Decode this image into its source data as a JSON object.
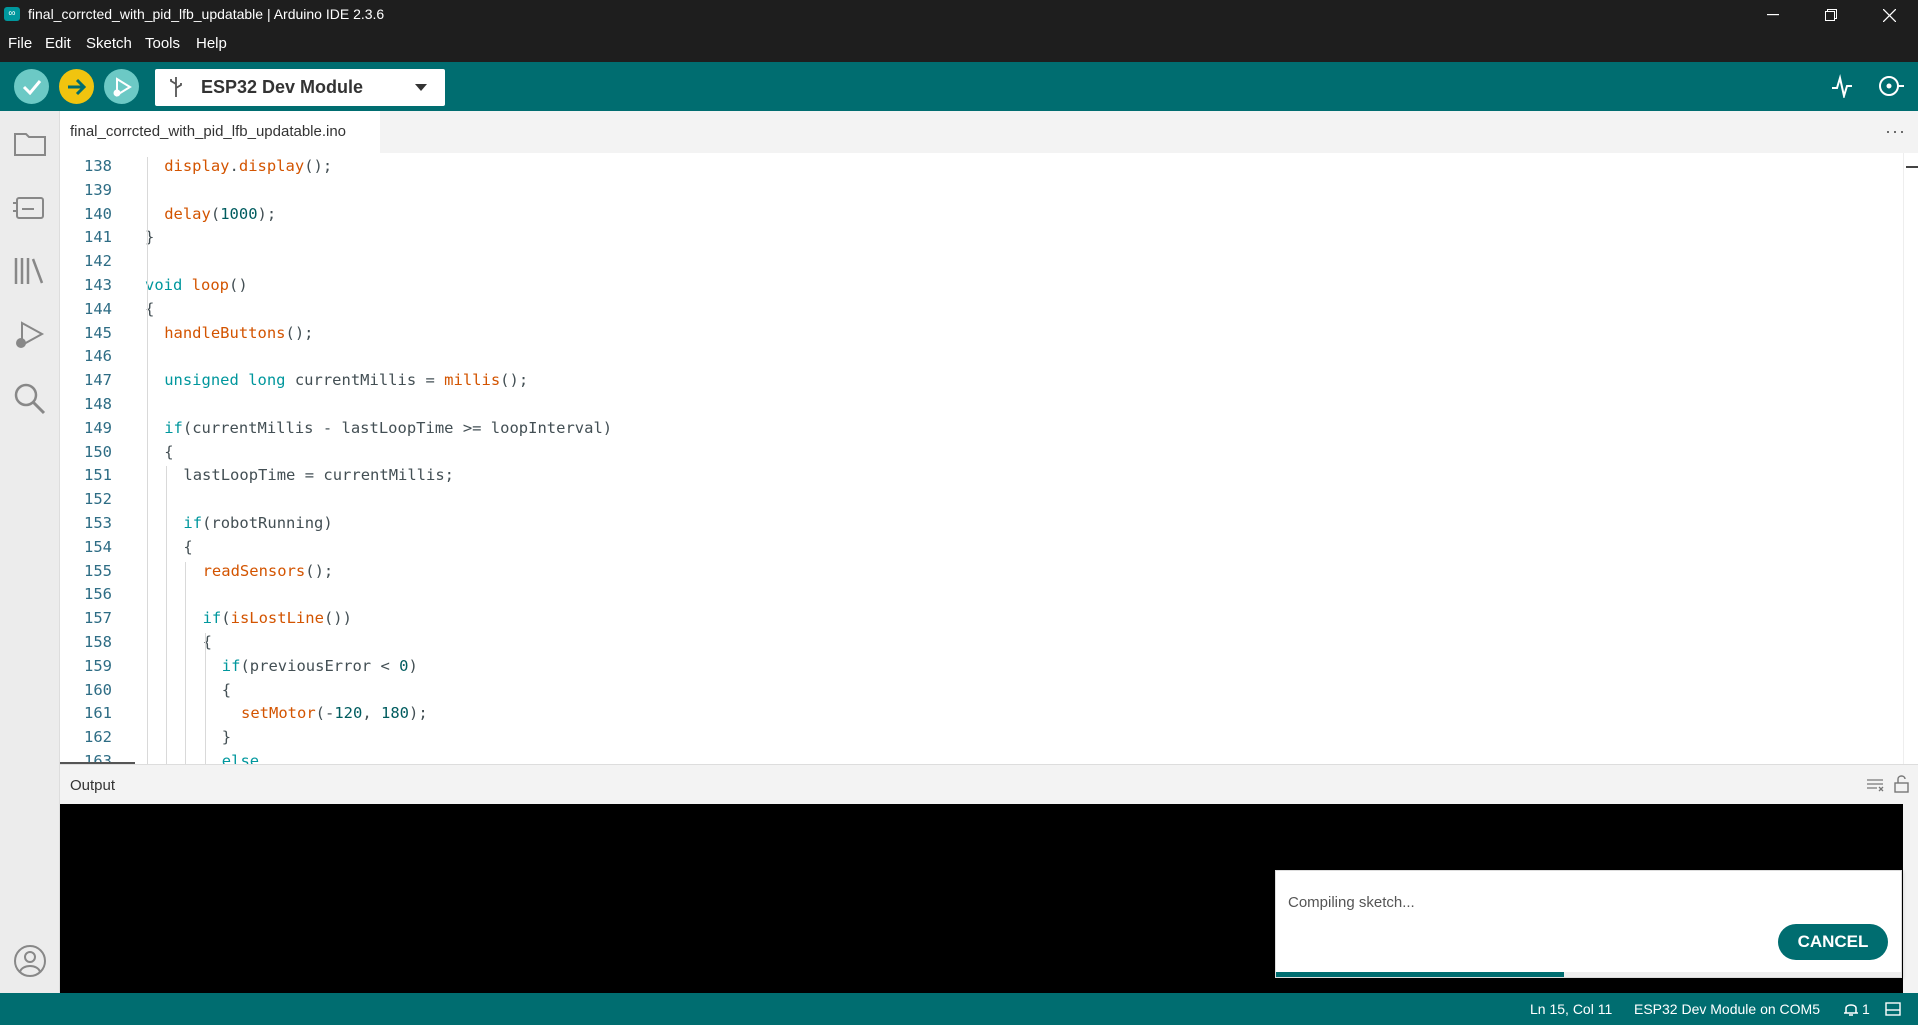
{
  "window": {
    "title": "final_corrcted_with_pid_lfb_updatable | Arduino IDE 2.3.6",
    "logo_symbol": "∞"
  },
  "menu": [
    "File",
    "Edit",
    "Sketch",
    "Tools",
    "Help"
  ],
  "toolbar": {
    "board": "ESP32 Dev Module",
    "colors": {
      "verify": "#6cc9c5",
      "upload": "#f1c40f",
      "bar": "#006d70"
    },
    "icons": [
      "checkmark-icon",
      "arrow-right-icon",
      "debug-icon",
      "serial-plotter-icon",
      "serial-monitor-icon"
    ]
  },
  "sidebar": {
    "icons": [
      "folder-icon",
      "board-manager-icon",
      "library-icon",
      "debug-icon",
      "search-icon",
      "account-icon"
    ]
  },
  "editor": {
    "tab_label": "final_corrcted_with_pid_lfb_updatable.ino",
    "more_label": "···",
    "lines": [
      {
        "n": "138",
        "indent": 1,
        "tokens": [
          [
            "fn",
            "display"
          ],
          [
            "",
            "."
          ],
          [
            "fn",
            "display"
          ],
          [
            "",
            "();"
          ]
        ]
      },
      {
        "n": "139",
        "indent": 0,
        "tokens": []
      },
      {
        "n": "140",
        "indent": 1,
        "tokens": [
          [
            "fn",
            "delay"
          ],
          [
            "",
            "("
          ],
          [
            "num",
            "1000"
          ],
          [
            "",
            ");"
          ]
        ]
      },
      {
        "n": "141",
        "indent": 0,
        "tokens": [
          [
            "",
            "}"
          ]
        ]
      },
      {
        "n": "142",
        "indent": 0,
        "tokens": []
      },
      {
        "n": "143",
        "indent": 0,
        "tokens": [
          [
            "kw",
            "void"
          ],
          [
            "",
            " "
          ],
          [
            "fn",
            "loop"
          ],
          [
            "",
            "()"
          ]
        ]
      },
      {
        "n": "144",
        "indent": 0,
        "tokens": [
          [
            "",
            "{"
          ]
        ]
      },
      {
        "n": "145",
        "indent": 1,
        "tokens": [
          [
            "fn",
            "handleButtons"
          ],
          [
            "",
            "();"
          ]
        ]
      },
      {
        "n": "146",
        "indent": 0,
        "tokens": []
      },
      {
        "n": "147",
        "indent": 1,
        "tokens": [
          [
            "kw",
            "unsigned"
          ],
          [
            "",
            " "
          ],
          [
            "kw",
            "long"
          ],
          [
            "",
            " currentMillis = "
          ],
          [
            "fn",
            "millis"
          ],
          [
            "",
            "();"
          ]
        ]
      },
      {
        "n": "148",
        "indent": 0,
        "tokens": []
      },
      {
        "n": "149",
        "indent": 1,
        "tokens": [
          [
            "kw",
            "if"
          ],
          [
            "",
            "(currentMillis - lastLoopTime >= loopInterval)"
          ]
        ]
      },
      {
        "n": "150",
        "indent": 1,
        "tokens": [
          [
            "",
            "{"
          ]
        ]
      },
      {
        "n": "151",
        "indent": 2,
        "tokens": [
          [
            "",
            "lastLoopTime = currentMillis;"
          ]
        ]
      },
      {
        "n": "152",
        "indent": 0,
        "tokens": []
      },
      {
        "n": "153",
        "indent": 2,
        "tokens": [
          [
            "kw",
            "if"
          ],
          [
            "",
            "(robotRunning)"
          ]
        ]
      },
      {
        "n": "154",
        "indent": 2,
        "tokens": [
          [
            "",
            "{"
          ]
        ]
      },
      {
        "n": "155",
        "indent": 3,
        "tokens": [
          [
            "fn",
            "readSensors"
          ],
          [
            "",
            "();"
          ]
        ]
      },
      {
        "n": "156",
        "indent": 0,
        "tokens": []
      },
      {
        "n": "157",
        "indent": 3,
        "tokens": [
          [
            "kw",
            "if"
          ],
          [
            "",
            "("
          ],
          [
            "fn",
            "isLostLine"
          ],
          [
            "",
            "())"
          ]
        ]
      },
      {
        "n": "158",
        "indent": 3,
        "tokens": [
          [
            "",
            "{"
          ]
        ]
      },
      {
        "n": "159",
        "indent": 4,
        "tokens": [
          [
            "kw",
            "if"
          ],
          [
            "",
            "(previousError < "
          ],
          [
            "num",
            "0"
          ],
          [
            "",
            ")"
          ]
        ]
      },
      {
        "n": "160",
        "indent": 4,
        "tokens": [
          [
            "",
            "{"
          ]
        ]
      },
      {
        "n": "161",
        "indent": 5,
        "tokens": [
          [
            "fn",
            "setMotor"
          ],
          [
            "",
            "(-"
          ],
          [
            "num",
            "120"
          ],
          [
            "",
            ", "
          ],
          [
            "num",
            "180"
          ],
          [
            "",
            ");"
          ]
        ]
      },
      {
        "n": "162",
        "indent": 4,
        "tokens": [
          [
            "",
            "}"
          ]
        ]
      },
      {
        "n": "163",
        "indent": 4,
        "tokens": [
          [
            "kw",
            "else"
          ]
        ]
      }
    ]
  },
  "output": {
    "title": "Output",
    "notification": {
      "text": "Compiling sketch...",
      "button": "CANCEL",
      "progress": 0.46
    }
  },
  "status": {
    "position": "Ln 15, Col 11",
    "board_port": "ESP32 Dev Module on COM5",
    "notifications_count": "1"
  }
}
